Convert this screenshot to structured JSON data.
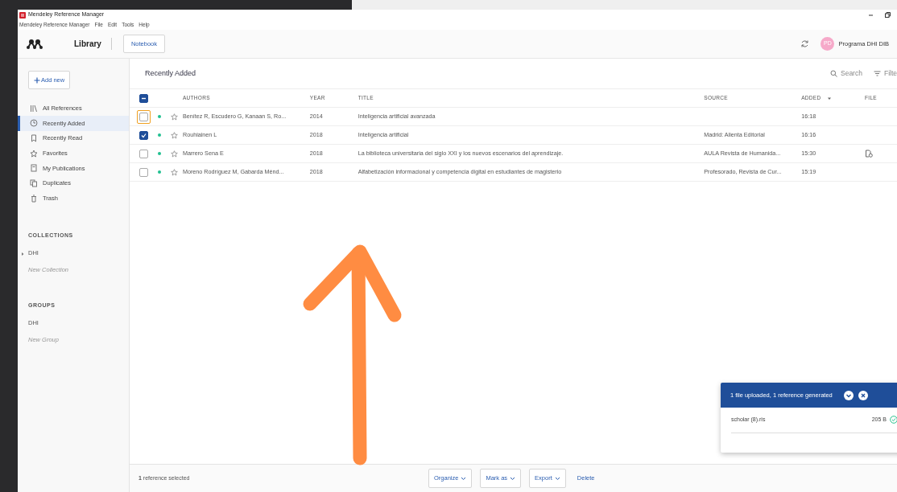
{
  "window": {
    "title": "Mendeley Reference Manager",
    "menu": [
      "Mendeley Reference Manager",
      "File",
      "Edit",
      "Tools",
      "Help"
    ]
  },
  "toolbar": {
    "tabs": [
      {
        "label": "Library",
        "selected": true
      },
      {
        "label": "Notebook",
        "selected": false
      }
    ],
    "user": {
      "initials": "PD",
      "name": "Programa DHI DIB"
    }
  },
  "sidebar": {
    "add_button": "Add new",
    "items": [
      {
        "label": "All References",
        "selected": false
      },
      {
        "label": "Recently Added",
        "selected": true
      },
      {
        "label": "Recently Read",
        "selected": false
      },
      {
        "label": "Favorites",
        "selected": false
      },
      {
        "label": "My Publications",
        "selected": false
      },
      {
        "label": "Duplicates",
        "selected": false
      },
      {
        "label": "Trash",
        "selected": false
      }
    ],
    "collections": {
      "heading": "COLLECTIONS",
      "items": [
        {
          "label": "DHI",
          "expanded": false
        }
      ],
      "new_label": "New Collection"
    },
    "groups": {
      "heading": "GROUPS",
      "items": [
        {
          "label": "DHI"
        }
      ],
      "new_label": "New Group"
    }
  },
  "content": {
    "heading": "Recently Added",
    "search": "Search",
    "filter": "Filte"
  },
  "table": {
    "select_all_indeterminate": true,
    "columns": [
      {
        "label": "AUTHORS",
        "sorted": false
      },
      {
        "label": "YEAR",
        "sorted": false
      },
      {
        "label": "TITLE",
        "sorted": false
      },
      {
        "label": "SOURCE",
        "sorted": false
      },
      {
        "label": "ADDED",
        "sorted": true
      },
      {
        "label": "FILE",
        "sorted": false
      }
    ],
    "rows": [
      {
        "checked": false,
        "focused": true,
        "unread": true,
        "starred": false,
        "authors": "Benítez R, Escudero G, Kanaan S, Ro...",
        "year": "2014",
        "title": "Inteligencia artificial avanzada",
        "source": "",
        "added": "16:18",
        "has_file": false
      },
      {
        "checked": true,
        "focused": false,
        "unread": true,
        "starred": false,
        "authors": "Rouhiainen L",
        "year": "2018",
        "title": "Inteligencia artificial",
        "source": "Madrid: Alienta Editorial",
        "added": "16:16",
        "has_file": false
      },
      {
        "checked": false,
        "focused": false,
        "unread": true,
        "starred": false,
        "authors": "Marrero Sena E",
        "year": "2018",
        "title": "La biblioteca universitaria del siglo XXI y los nuevos escenarios del aprendizaje.",
        "source": "AULA Revista de Humanida...",
        "added": "15:30",
        "has_file": true
      },
      {
        "checked": false,
        "focused": false,
        "unread": true,
        "starred": false,
        "authors": "Moreno Rodríguez M, Gabarda Ménd...",
        "year": "2018",
        "title": "Alfabetización informacional y competencia digital en estudiantes de magisterio",
        "source": "Profesorado, Revista de Cur...",
        "added": "15:19",
        "has_file": false
      }
    ]
  },
  "footer": {
    "status": "**1** reference selected",
    "actions": [
      {
        "label": "Organize",
        "kind": "menu"
      },
      {
        "label": "Mark as",
        "kind": "menu"
      },
      {
        "label": "Export",
        "kind": "menu"
      },
      {
        "label": "Delete",
        "kind": "link"
      }
    ]
  },
  "upload_toast": {
    "title": "1 file uploaded, 1 reference generated",
    "files": [
      {
        "name": "scholar (8).ris",
        "size": "205 B",
        "done": true
      }
    ]
  }
}
